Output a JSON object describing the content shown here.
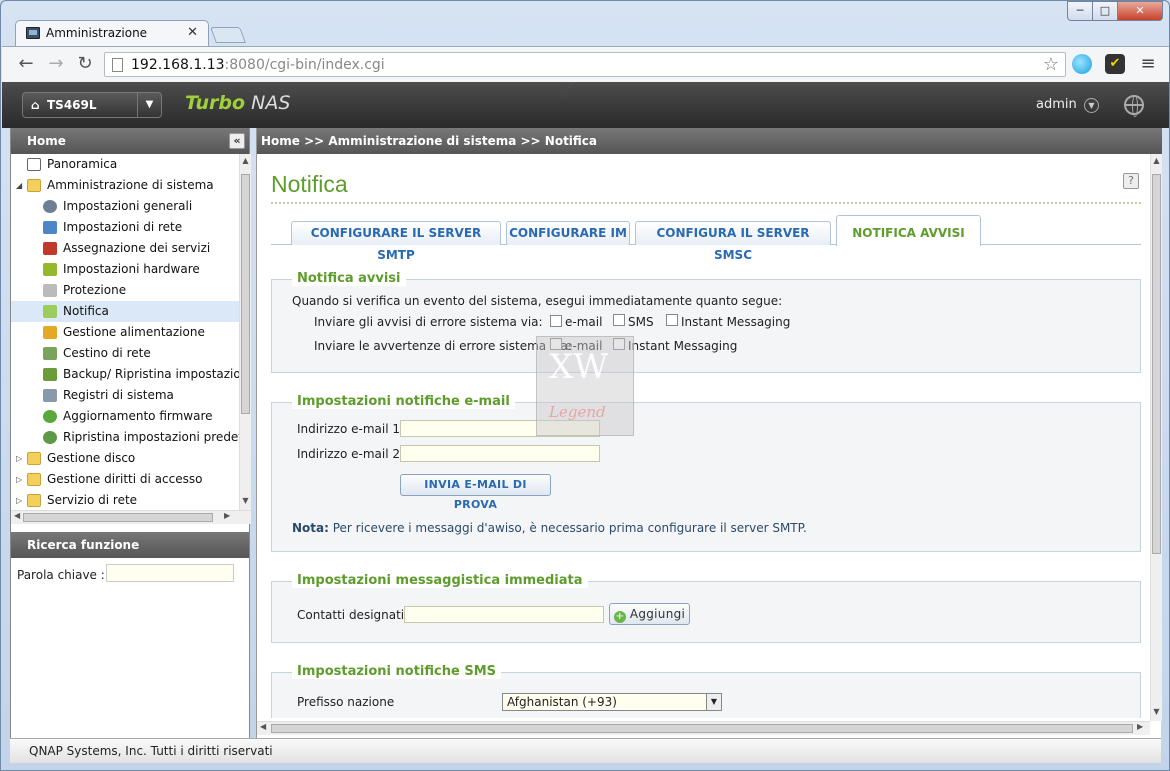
{
  "browser": {
    "tab_title": "Amministrazione",
    "tab_close": "✕",
    "url_host": "192.168.1.13",
    "url_rest": ":8080/cgi-bin/index.cgi",
    "win_min": "─",
    "win_max": "□",
    "win_close": "✕"
  },
  "header": {
    "device_name": "TS469L",
    "brand_turbo": "Turbo",
    "brand_nas": "NAS",
    "user": "admin"
  },
  "sidebar": {
    "title": "Home",
    "collapse_symbol": "«",
    "items": [
      {
        "label": "Panoramica"
      },
      {
        "label": "Amministrazione di sistema"
      },
      {
        "label": "Impostazioni generali"
      },
      {
        "label": "Impostazioni di rete"
      },
      {
        "label": "Assegnazione dei servizi"
      },
      {
        "label": "Impostazioni hardware"
      },
      {
        "label": "Protezione"
      },
      {
        "label": "Notifica"
      },
      {
        "label": "Gestione alimentazione"
      },
      {
        "label": "Cestino di rete"
      },
      {
        "label": "Backup/ Ripristina impostazion"
      },
      {
        "label": "Registri di sistema"
      },
      {
        "label": "Aggiornamento firmware"
      },
      {
        "label": "Ripristina impostazioni predefir"
      },
      {
        "label": "Gestione disco"
      },
      {
        "label": "Gestione diritti di accesso"
      },
      {
        "label": "Servizio di rete"
      }
    ],
    "search_title": "Ricerca funzione",
    "keyword_label": "Parola chiave :"
  },
  "content": {
    "breadcrumb": "Home >> Amministrazione di sistema >> Notifica",
    "page_title": "Notifica",
    "tabs": [
      {
        "label": "CONFIGURARE IL SERVER SMTP"
      },
      {
        "label": "CONFIGURARE IM"
      },
      {
        "label": "CONFIGURA IL SERVER SMSC"
      },
      {
        "label": "NOTIFICA AVVISI"
      }
    ],
    "alerts": {
      "legend": "Notifica avvisi",
      "intro": "Quando si verifica un evento del sistema, esegui immediatamente quanto segue:",
      "error_label": "Inviare gli avvisi di errore sistema via:",
      "warning_label": "Inviare le avvertenze di errore sistema via:",
      "opt_email": "e-mail",
      "opt_sms": "SMS",
      "opt_im": "Instant Messaging"
    },
    "email": {
      "legend": "Impostazioni notifiche e-mail",
      "email1_label": "Indirizzo e-mail 1:",
      "email2_label": "Indirizzo e-mail 2:",
      "test_button": "INVIA E-MAIL DI PROVA",
      "note_label": "Nota:",
      "note_text": " Per ricevere i messaggi d'awiso, è necessario prima configurare il server SMTP."
    },
    "im": {
      "legend": "Impostazioni messaggistica immediata",
      "contacts_label": "Contatti designati:",
      "add_button": "Aggiungi"
    },
    "sms": {
      "legend": "Impostazioni notifiche SMS",
      "prefix_label": "Prefisso nazione",
      "prefix_value": "Afghanistan (+93)"
    }
  },
  "footer": {
    "copyright": "QNAP Systems, Inc. Tutti i diritti riservati"
  },
  "watermark": {
    "line1": "XW",
    "line2": "Legend"
  }
}
